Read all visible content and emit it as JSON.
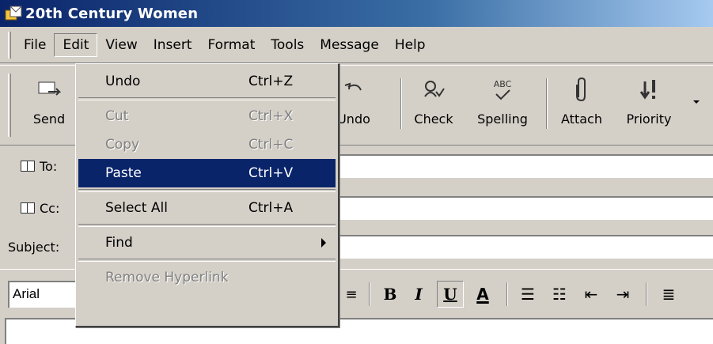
{
  "window": {
    "title": "20th Century Women"
  },
  "menubar": {
    "items": [
      {
        "label": "File"
      },
      {
        "label": "Edit"
      },
      {
        "label": "View"
      },
      {
        "label": "Insert"
      },
      {
        "label": "Format"
      },
      {
        "label": "Tools"
      },
      {
        "label": "Message"
      },
      {
        "label": "Help"
      }
    ]
  },
  "toolbar": {
    "send": "Send",
    "undo": "Undo",
    "check": "Check",
    "spelling": "Spelling",
    "attach": "Attach",
    "priority": "Priority",
    "spelling_icon_text": "ABC"
  },
  "fields": {
    "to": "To:",
    "cc": "Cc:",
    "subject": "Subject:"
  },
  "formatbar": {
    "font": "Arial",
    "bold": "B",
    "italic": "I",
    "underline": "U",
    "font_color": "A"
  },
  "edit_menu": {
    "undo": {
      "label": "Undo",
      "shortcut": "Ctrl+Z"
    },
    "cut": {
      "label": "Cut",
      "shortcut": "Ctrl+X"
    },
    "copy": {
      "label": "Copy",
      "shortcut": "Ctrl+C"
    },
    "paste": {
      "label": "Paste",
      "shortcut": "Ctrl+V"
    },
    "select_all": {
      "label": "Select All",
      "shortcut": "Ctrl+A"
    },
    "find": {
      "label": "Find"
    },
    "remove_hyperlink": {
      "label": "Remove Hyperlink"
    }
  },
  "colors": {
    "title_bar": "#0a246a",
    "selection": "#0a246a",
    "chrome": "#d4d0c8"
  }
}
